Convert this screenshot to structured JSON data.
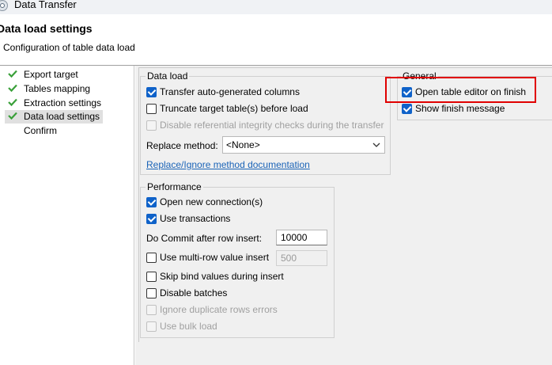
{
  "window": {
    "title": "Data Transfer"
  },
  "header": {
    "title": "Data load settings",
    "subtitle": "Configuration of table data load"
  },
  "sidebar": {
    "items": [
      {
        "label": "Export target",
        "done": true,
        "selected": false
      },
      {
        "label": "Tables mapping",
        "done": true,
        "selected": false
      },
      {
        "label": "Extraction settings",
        "done": true,
        "selected": false
      },
      {
        "label": "Data load settings",
        "done": true,
        "selected": true
      },
      {
        "label": "Confirm",
        "done": false,
        "selected": false
      }
    ]
  },
  "data_load": {
    "title": "Data load",
    "transfer_auto_generated": {
      "label": "Transfer auto-generated columns",
      "checked": true
    },
    "truncate_target": {
      "label": "Truncate target table(s) before load",
      "checked": false
    },
    "disable_integrity": {
      "label": "Disable referential integrity checks during the transfer",
      "checked": false,
      "disabled": true
    },
    "replace_method": {
      "label": "Replace method:",
      "value": "<None>"
    },
    "doc_link": "Replace/Ignore method documentation"
  },
  "performance": {
    "title": "Performance",
    "open_new_connection": {
      "label": "Open new connection(s)",
      "checked": true
    },
    "use_transactions": {
      "label": "Use transactions",
      "checked": true
    },
    "do_commit": {
      "label": "Do Commit after row insert:",
      "value": "10000"
    },
    "multi_row_insert": {
      "label": "Use multi-row value insert",
      "checked": false,
      "value": "500"
    },
    "skip_bind": {
      "label": "Skip bind values during insert",
      "checked": false
    },
    "disable_batches": {
      "label": "Disable batches",
      "checked": false
    },
    "ignore_duplicates": {
      "label": "Ignore duplicate rows errors",
      "checked": false,
      "disabled": true
    },
    "use_bulk_load": {
      "label": "Use bulk load",
      "checked": false,
      "disabled": true
    }
  },
  "general": {
    "title": "General",
    "open_table_editor": {
      "label": "Open table editor on finish",
      "checked": true
    },
    "show_finish_message": {
      "label": "Show finish message",
      "checked": true
    }
  },
  "colors": {
    "accent": "#0f62c9",
    "highlight": "#e00000",
    "check_mark": "#3aa03a",
    "link": "#1a63b7"
  }
}
